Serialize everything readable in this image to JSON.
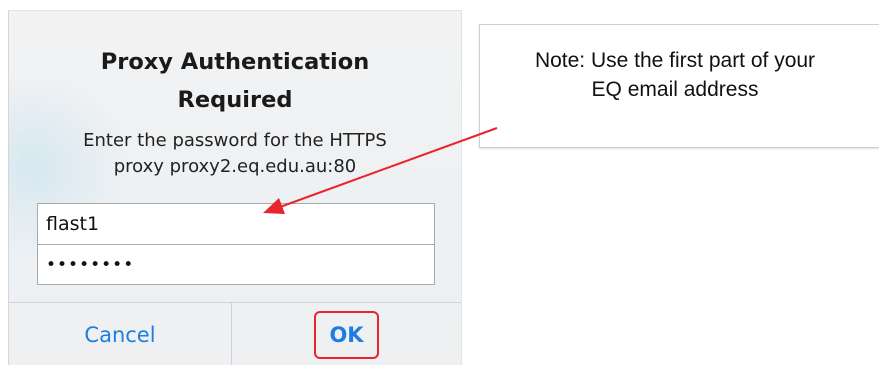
{
  "dialog": {
    "title": "Proxy Authentication\nRequired",
    "message": "Enter the password for the HTTPS\nproxy proxy2.eq.edu.au:80",
    "username_value": "flast1",
    "password_value": "••••••••",
    "cancel_label": "Cancel",
    "ok_label": "OK"
  },
  "note": {
    "text": "Note: Use the first part of your\nEQ email address"
  },
  "colors": {
    "button_blue": "#1f7de0",
    "highlight_red": "#e8242d",
    "arrow_red": "#e8242d"
  }
}
